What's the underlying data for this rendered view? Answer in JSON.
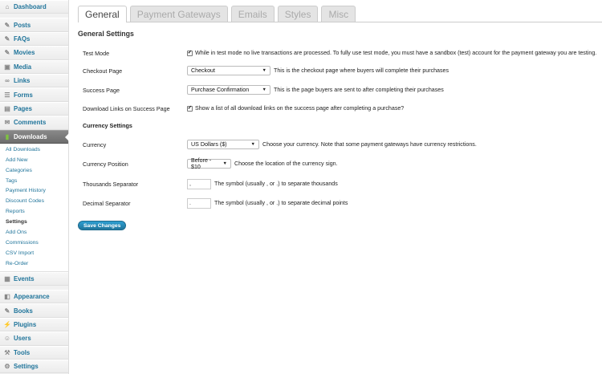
{
  "sidebar": {
    "top_items": [
      {
        "label": "Dashboard",
        "icon": "dashboard-icon"
      },
      {
        "label": "Posts",
        "icon": "pin-icon"
      },
      {
        "label": "FAQs",
        "icon": "pin-icon"
      },
      {
        "label": "Movies",
        "icon": "pin-icon"
      },
      {
        "label": "Media",
        "icon": "media-icon"
      },
      {
        "label": "Links",
        "icon": "link-icon"
      },
      {
        "label": "Forms",
        "icon": "forms-icon"
      },
      {
        "label": "Pages",
        "icon": "pages-icon"
      },
      {
        "label": "Comments",
        "icon": "comments-icon"
      },
      {
        "label": "Downloads",
        "icon": "downloads-icon"
      }
    ],
    "sub_items": [
      "All Downloads",
      "Add New",
      "Categories",
      "Tags",
      "Payment History",
      "Discount Codes",
      "Reports",
      "Settings",
      "Add Ons",
      "Commissions",
      "CSV Import",
      "Re-Order"
    ],
    "bottom_items": [
      {
        "label": "Events",
        "icon": "events-icon"
      },
      {
        "label": "Appearance",
        "icon": "appearance-icon"
      },
      {
        "label": "Books",
        "icon": "pin-icon"
      },
      {
        "label": "Plugins",
        "icon": "plugins-icon"
      },
      {
        "label": "Users",
        "icon": "users-icon"
      },
      {
        "label": "Tools",
        "icon": "tools-icon"
      },
      {
        "label": "Settings",
        "icon": "settings-icon"
      }
    ]
  },
  "tabs": [
    "General",
    "Payment Gateways",
    "Emails",
    "Styles",
    "Misc"
  ],
  "active_tab": "General",
  "page": {
    "section_title": "General Settings",
    "test_mode": {
      "label": "Test Mode",
      "desc": "While in test mode no live transactions are processed. To fully use test mode, you must have a sandbox (test) account for the payment gateway you are testing."
    },
    "checkout_page": {
      "label": "Checkout Page",
      "value": "Checkout",
      "desc": "This is the checkout page where buyers will complete their purchases"
    },
    "success_page": {
      "label": "Success Page",
      "value": "Purchase Confirmation",
      "desc": "This is the page buyers are sent to after completing their purchases"
    },
    "download_links": {
      "label": "Download Links on Success Page",
      "desc": "Show a list of all download links on the success page after completing a purchase?"
    },
    "currency_heading": "Currency Settings",
    "currency": {
      "label": "Currency",
      "value": "US Dollars ($)",
      "desc": "Choose your currency. Note that some payment gateways have currency restrictions."
    },
    "currency_position": {
      "label": "Currency Position",
      "value": "Before - $10",
      "desc": "Choose the location of the currency sign."
    },
    "thousands_sep": {
      "label": "Thousands Separator",
      "value": ",",
      "desc": "The symbol (usually , or .) to separate thousands"
    },
    "decimal_sep": {
      "label": "Decimal Separator",
      "value": ".",
      "desc": "The symbol (usually , or .) to separate decimal points"
    },
    "save_label": "Save Changes"
  }
}
